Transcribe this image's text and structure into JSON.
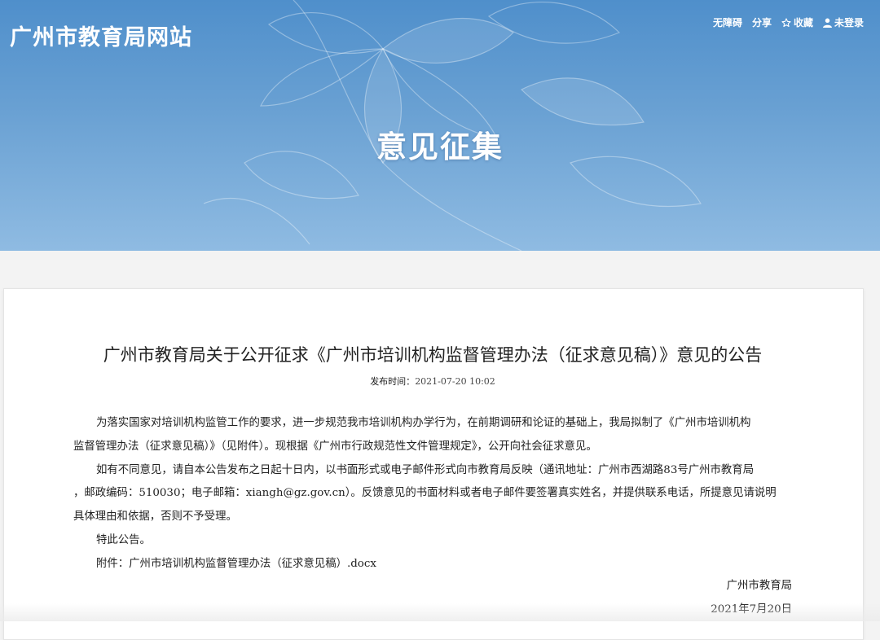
{
  "header": {
    "site_title": "广州市教育局网站",
    "links": {
      "accessibility": "无障碍",
      "share": "分享",
      "favorite": "收藏",
      "login": "未登录"
    },
    "banner_heading": "意见征集"
  },
  "article": {
    "title": "广州市教育局关于公开征求《广州市培训机构监督管理办法（征求意见稿）》意见的公告",
    "publish_label": "发布时间：",
    "publish_time": "2021-07-20 10:02",
    "paragraphs": {
      "p1_line1": "为落实国家对培训机构监管工作的要求，进一步规范我市培训机构办学行为，在前期调研和论证的基础上，我局拟制了《广州市培训机构",
      "p1_line2": "监督管理办法（征求意见稿）》（见附件）。现根据《广州市行政规范性文件管理规定》，公开向社会征求意见。",
      "p2_line1": "如有不同意见，请自本公告发布之日起十日内，以书面形式或电子邮件形式向市教育局反映（通讯地址：广州市西湖路83号广州市教育局",
      "p2_line2": "，邮政编码：510030；电子邮箱：xiangh@gz.gov.cn）。反馈意见的书面材料或者电子邮件要签署真实姓名，并提供联系电话，所提意见请说明",
      "p2_line3": "具体理由和依据，否则不予受理。",
      "p3": "特此公告。"
    },
    "attachment_label": "附件：",
    "attachment_name": "广州市培训机构监督管理办法（征求意见稿）.docx",
    "signature_org": "广州市教育局",
    "signature_date": "2021年7月20日"
  },
  "icons": {
    "favorite": "star-outline-icon",
    "login": "user-icon"
  },
  "colors": {
    "banner_top": "#4f8fcb",
    "banner_bottom": "#8fbbe2",
    "page_bg": "#f3f3f3"
  }
}
